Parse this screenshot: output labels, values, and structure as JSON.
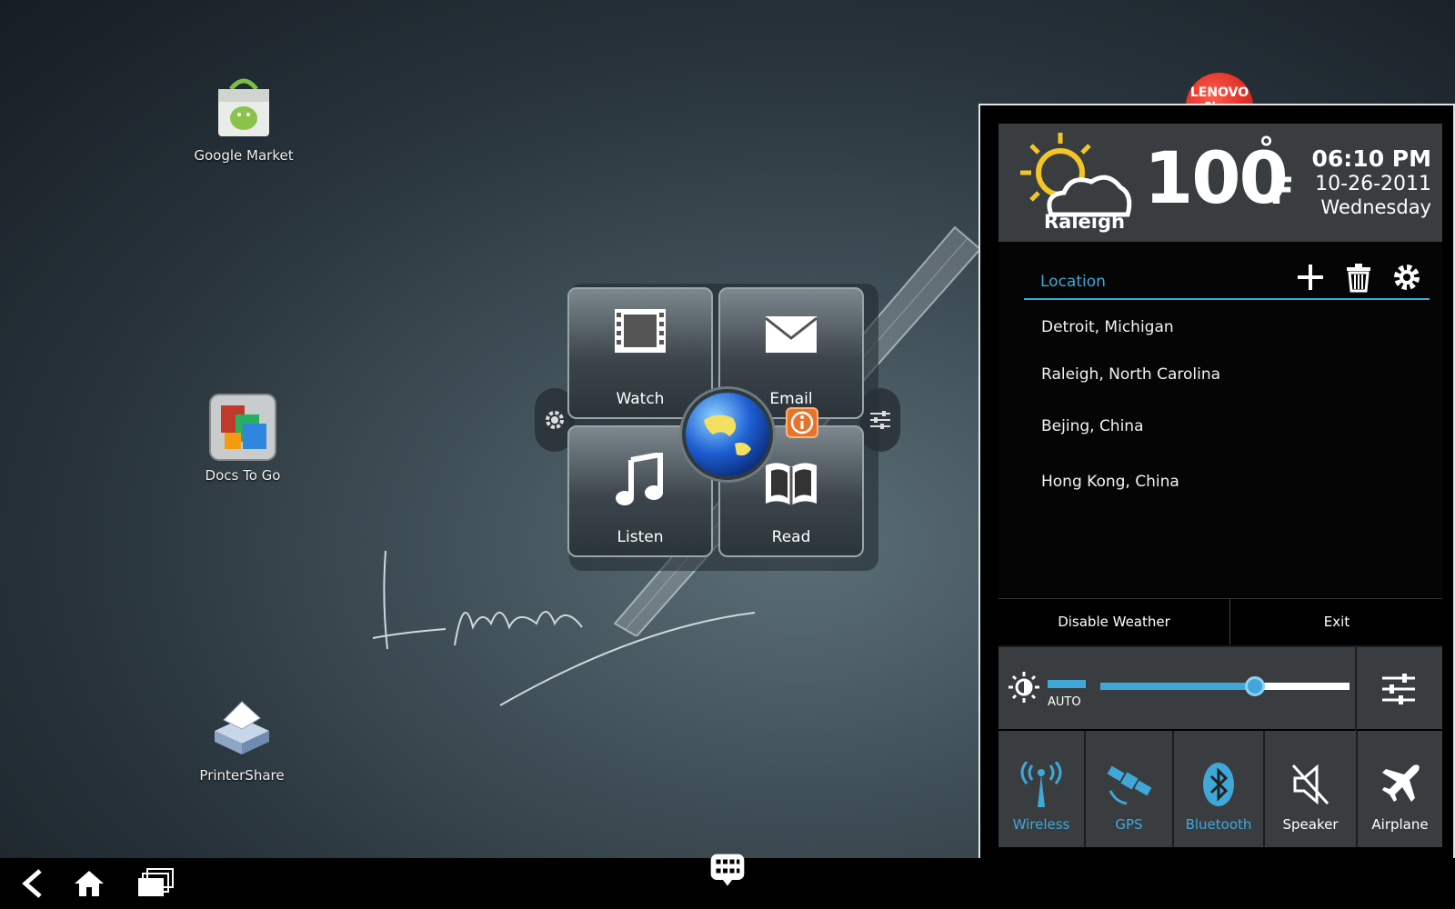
{
  "desktop": {
    "icons": [
      {
        "label": "Google Market",
        "icon": "market-bag-icon"
      },
      {
        "label": "Docs To Go",
        "icon": "docs-icon"
      },
      {
        "label": "PrinterShare",
        "icon": "printer-icon"
      }
    ],
    "shop_badge": {
      "line1": "LENOVO",
      "line2": "Shop"
    },
    "signature": "Lenovo"
  },
  "hub": {
    "tiles": [
      {
        "label": "Watch",
        "icon": "film-icon"
      },
      {
        "label": "Email",
        "icon": "envelope-icon"
      },
      {
        "label": "Listen",
        "icon": "music-note-icon"
      },
      {
        "label": "Read",
        "icon": "book-icon"
      }
    ]
  },
  "weather": {
    "city": "Raleigh",
    "temperature": "100",
    "degree": "°",
    "unit": "F",
    "time": "06:10 PM",
    "date": "10-26-2011",
    "weekday": "Wednesday",
    "location_header": "Location",
    "locations": [
      "Detroit, Michigan",
      "Raleigh, North Carolina",
      "Bejing, China",
      "Hong Kong, China"
    ],
    "disable_label": "Disable Weather",
    "exit_label": "Exit"
  },
  "quick_settings": {
    "brightness_auto_label": "AUTO",
    "brightness_level": 0.62,
    "toggles": [
      {
        "label": "Wireless",
        "icon": "wireless-icon",
        "active": true
      },
      {
        "label": "GPS",
        "icon": "gps-satellite-icon",
        "active": true
      },
      {
        "label": "Bluetooth",
        "icon": "bluetooth-icon",
        "active": true
      },
      {
        "label": "Speaker",
        "icon": "speaker-muted-icon",
        "active": false
      },
      {
        "label": "Airplane",
        "icon": "airplane-icon",
        "active": false
      }
    ]
  },
  "colors": {
    "accent": "#3fa8d8",
    "panel": "#3a3d40"
  }
}
